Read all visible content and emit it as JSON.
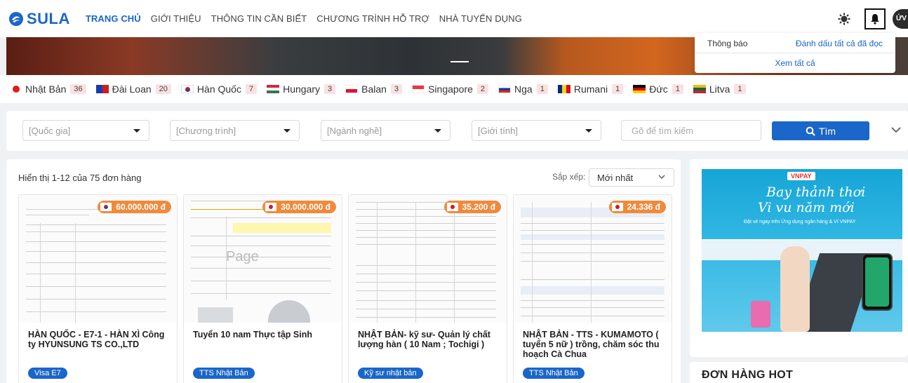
{
  "header": {
    "logo": "SULA",
    "nav": [
      "TRANG CHỦ",
      "GIỚI THIỆU",
      "THÔNG TIN CẦN BIẾT",
      "CHƯƠNG TRÌNH HỖ TRỢ",
      "NHÀ TUYỂN DỤNG"
    ],
    "avatar": "ỨV"
  },
  "notifications": {
    "title": "Thông báo",
    "mark_all": "Đánh dấu tất cả đã đọc",
    "view_all": "Xem tất cả"
  },
  "countries": [
    {
      "name": "Nhật Bản",
      "count": "36"
    },
    {
      "name": "Đài Loan",
      "count": "20"
    },
    {
      "name": "Hàn Quốc",
      "count": "7"
    },
    {
      "name": "Hungary",
      "count": "3"
    },
    {
      "name": "Balan",
      "count": "3"
    },
    {
      "name": "Singapore",
      "count": "2"
    },
    {
      "name": "Nga",
      "count": "1"
    },
    {
      "name": "Rumani",
      "count": "1"
    },
    {
      "name": "Đức",
      "count": "1"
    },
    {
      "name": "Litva",
      "count": "1"
    }
  ],
  "filters": {
    "country": "[Quốc gia]",
    "program": "[Chương trình]",
    "industry": "[Ngành nghề]",
    "gender": "[Giới tính]",
    "search_placeholder": "Gõ để tìm kiếm",
    "search_button": "Tìm"
  },
  "listing": {
    "count_text": "Hiển thị 1-12 của 75 đơn hàng",
    "sort_label": "Sắp xếp:",
    "sort_value": "Mới nhất",
    "watermark": "Page",
    "cards": [
      {
        "price": "60.000.000 đ",
        "title": "HÀN QUỐC - E7-1 - HÀN XÌ Công ty HYUNSUNG TS CO.,LTD",
        "tag": "Visa E7"
      },
      {
        "price": "30.000.000 đ",
        "title": "Tuyển 10 nam Thực tập Sinh",
        "tag": "TTS Nhật Bản"
      },
      {
        "price": "35.200 đ",
        "title": "NHẬT BẢN- kỹ sư- Quản lý chất lượng hàn ( 10 Nam ; Tochigi )",
        "tag": "Kỹ sư nhật bản"
      },
      {
        "price": "24.336 đ",
        "title": "NHẬT BẢN - TTS - KUMAMOTO ( tuyển 5 nữ ) trồng, chăm sóc thu hoạch Cà Chua",
        "tag": "TTS Nhật Bản"
      }
    ]
  },
  "ad": {
    "brand": "VNPAY",
    "line1": "Bay thảnh thơi",
    "line2": "Vi vu năm mới",
    "sub": "Đặt vé ngay trên Ứng dụng ngân hàng & Ví VNPAY"
  },
  "hot": {
    "title": "ĐƠN HÀNG HOT"
  }
}
